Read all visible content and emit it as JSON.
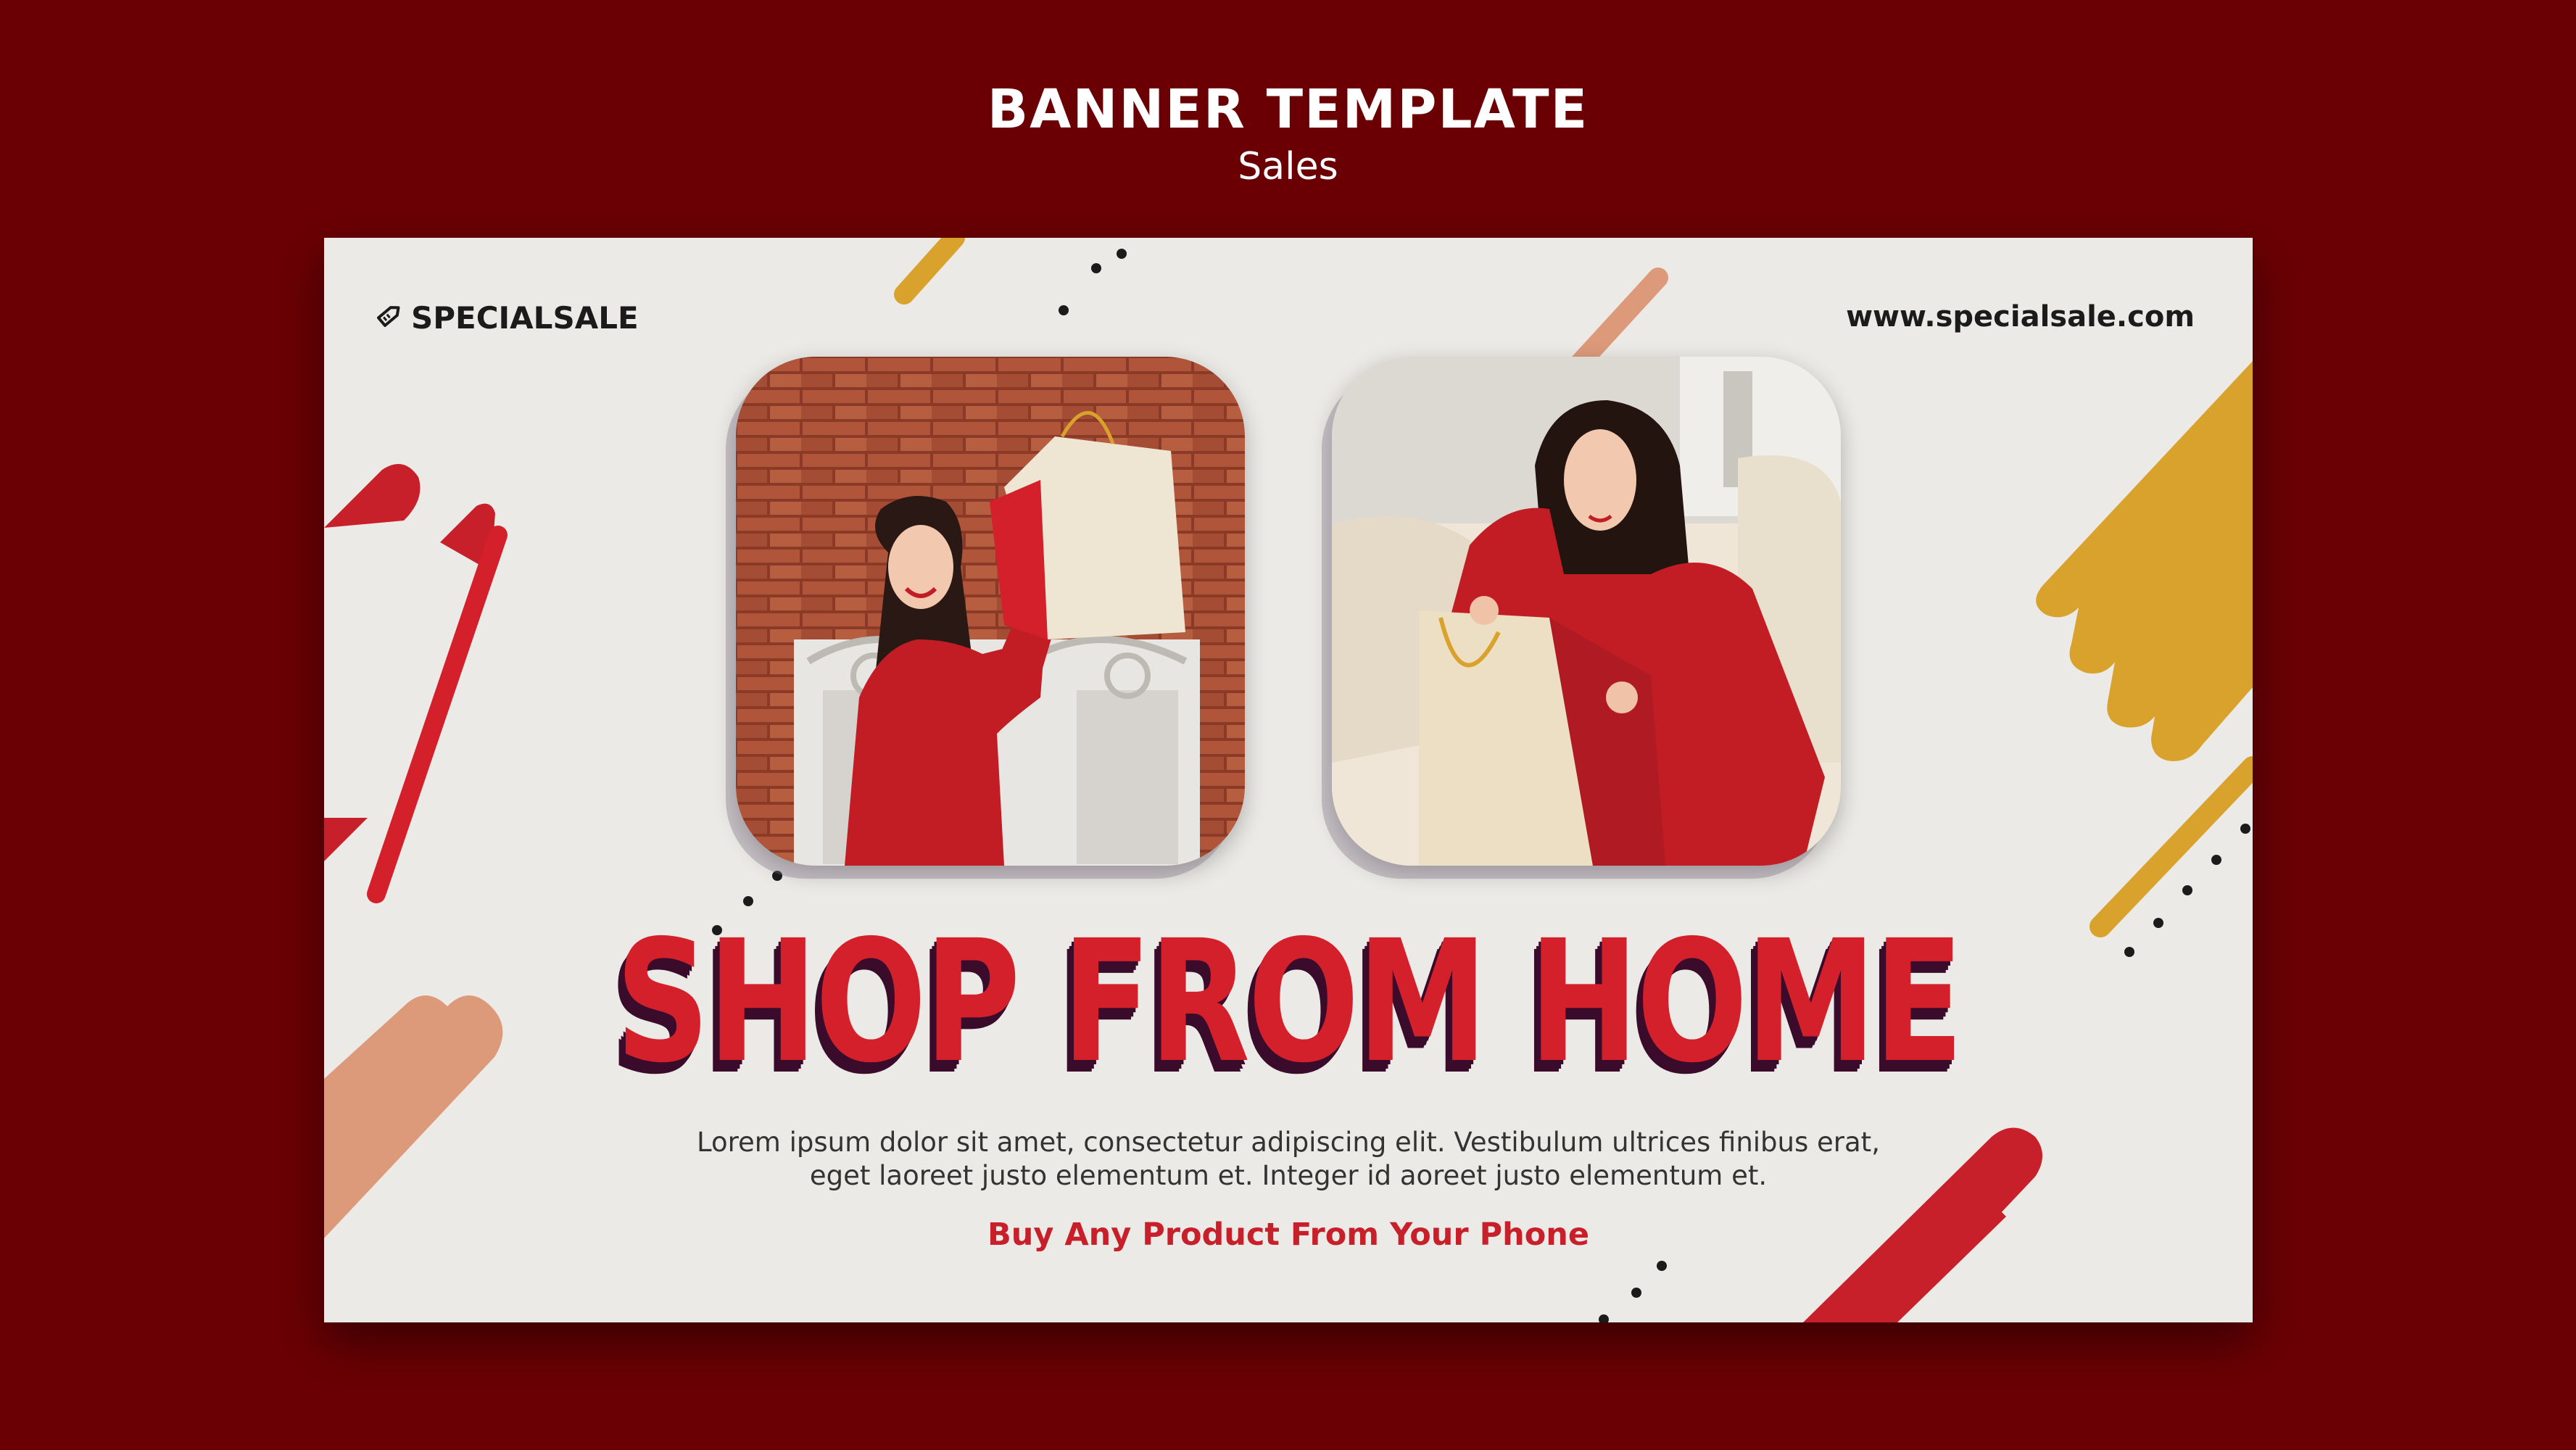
{
  "header": {
    "title": "BANNER TEMPLATE",
    "subtitle": "Sales"
  },
  "banner": {
    "brand": "SPECIALSALE",
    "brand_icon": "tag-icon",
    "website": "www.specialsale.com",
    "headline": "SHOP FROM HOME",
    "body": "Lorem ipsum dolor sit amet, consectetur adipiscing elit. Vestibulum ultrices finibus erat, eget laoreet justo elementum et. Integer id aoreet justo elementum et.",
    "cta": "Buy Any Product From Your Phone"
  },
  "colors": {
    "page_background": "#6a0004",
    "banner_background": "#eceae6",
    "accent_red": "#d4202b",
    "accent_gold": "#d9a22c",
    "accent_salmon": "#dc9a7a",
    "headline_shadow": "#3a0b2a"
  }
}
